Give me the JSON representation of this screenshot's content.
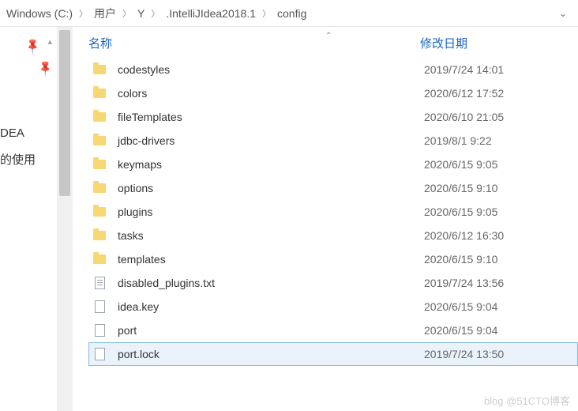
{
  "breadcrumb": {
    "items": [
      {
        "label": "Windows  (C:)"
      },
      {
        "label": "用户"
      },
      {
        "label": "Y"
      },
      {
        "label": ".IntelliJIdea2018.1"
      },
      {
        "label": "config"
      }
    ]
  },
  "sidebar": {
    "link1": "DEA",
    "link2": "的使用"
  },
  "columns": {
    "name": "名称",
    "modified": "修改日期"
  },
  "files": [
    {
      "name": "codestyles",
      "modified": "2019/7/24 14:01",
      "type": "folder",
      "selected": false
    },
    {
      "name": "colors",
      "modified": "2020/6/12 17:52",
      "type": "folder",
      "selected": false
    },
    {
      "name": "fileTemplates",
      "modified": "2020/6/10 21:05",
      "type": "folder",
      "selected": false
    },
    {
      "name": "jdbc-drivers",
      "modified": "2019/8/1 9:22",
      "type": "folder",
      "selected": false
    },
    {
      "name": "keymaps",
      "modified": "2020/6/15 9:05",
      "type": "folder",
      "selected": false
    },
    {
      "name": "options",
      "modified": "2020/6/15 9:10",
      "type": "folder",
      "selected": false
    },
    {
      "name": "plugins",
      "modified": "2020/6/15 9:05",
      "type": "folder",
      "selected": false
    },
    {
      "name": "tasks",
      "modified": "2020/6/12 16:30",
      "type": "folder",
      "selected": false
    },
    {
      "name": "templates",
      "modified": "2020/6/15 9:10",
      "type": "folder",
      "selected": false
    },
    {
      "name": "disabled_plugins.txt",
      "modified": "2019/7/24 13:56",
      "type": "text",
      "selected": false
    },
    {
      "name": "idea.key",
      "modified": "2020/6/15 9:04",
      "type": "file",
      "selected": false
    },
    {
      "name": "port",
      "modified": "2020/6/15 9:04",
      "type": "file",
      "selected": false
    },
    {
      "name": "port.lock",
      "modified": "2019/7/24 13:50",
      "type": "file",
      "selected": true
    }
  ],
  "watermark": "blog @51CTO博客"
}
